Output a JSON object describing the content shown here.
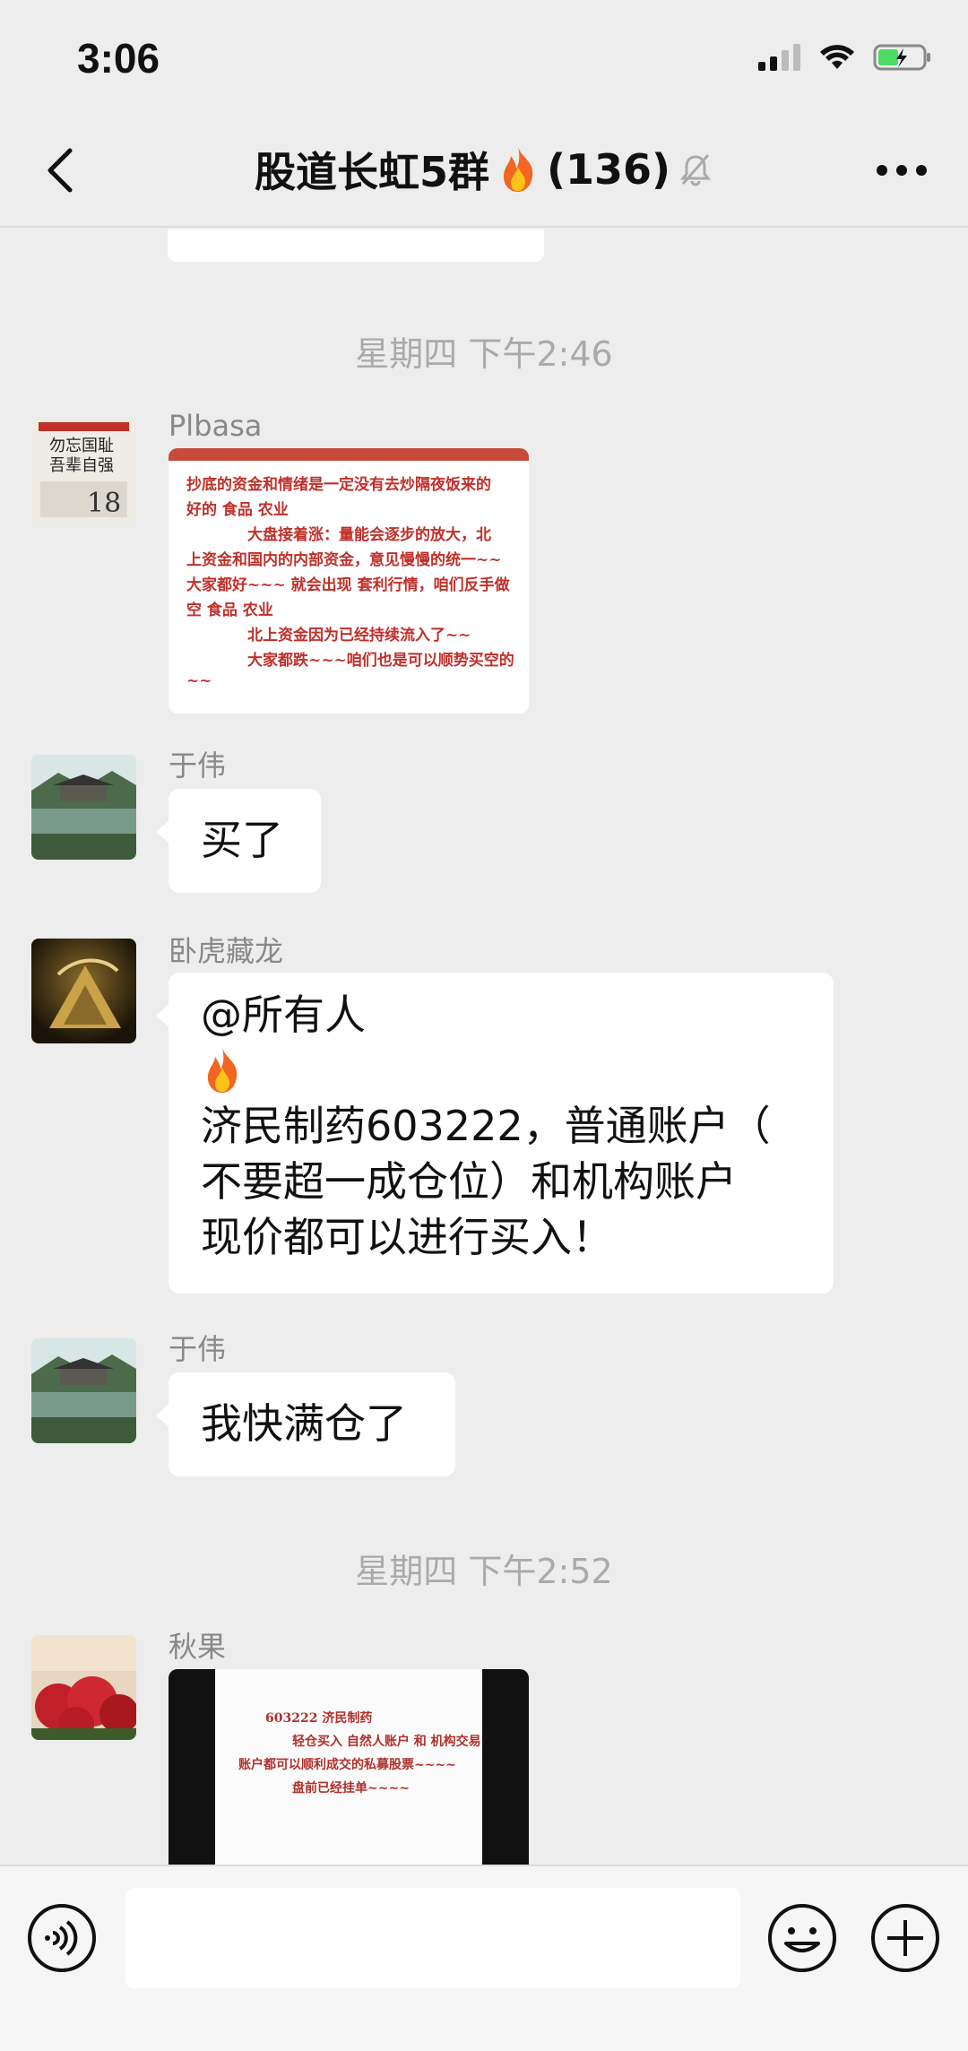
{
  "status_bar": {
    "time": "3:06"
  },
  "nav": {
    "title": "股道长虹5群",
    "member_count": "(136)"
  },
  "timestamps": [
    "星期四 下午2:46",
    "星期四 下午2:52"
  ],
  "messages": [
    {
      "sender": "Plbasa",
      "type": "image",
      "image_text": [
        "抄底的资金和情绪是一定没有去炒隔夜饭来的",
        "好的   食品   农业",
        "大盘接着涨：量能会逐步的放大，北",
        "上资金和国内的内部资金，意见慢慢的统一~~",
        "大家都好~~~ 就会出现 套利行情，咱们反手做",
        "空    食品   农业",
        "北上资金因为已经持续流入了~~",
        "大家都跌~~~咱们也是可以顺势买空的",
        "~~"
      ]
    },
    {
      "sender": "于伟",
      "type": "text",
      "text": "买了"
    },
    {
      "sender": "卧虎藏龙",
      "type": "text",
      "lines": [
        "@所有人",
        "🔥",
        "济民制药603222，普通账户（",
        "不要超一成仓位）和机构账户",
        "现价都可以进行买入！"
      ]
    },
    {
      "sender": "于伟",
      "type": "text",
      "text": "我快满仓了"
    },
    {
      "sender": "秋果",
      "type": "image",
      "image_text": [
        "603222  济民制药",
        "轻仓买入   自然人账户  和  机构交易",
        "账户都可以顺利成交的私募股票~~~~",
        "盘前已经挂单~~~~"
      ]
    }
  ],
  "icons": {
    "back": "chevron-left-icon",
    "mute": "bell-muted-icon",
    "more": "more-icon",
    "voice": "voice-icon",
    "emoji": "emoji-icon",
    "plus": "plus-icon",
    "fire": "fire-emoji"
  },
  "colors": {
    "background": "#ededed",
    "bubble": "#ffffff",
    "timestamp": "#aaaaaa",
    "sender": "#888888"
  }
}
